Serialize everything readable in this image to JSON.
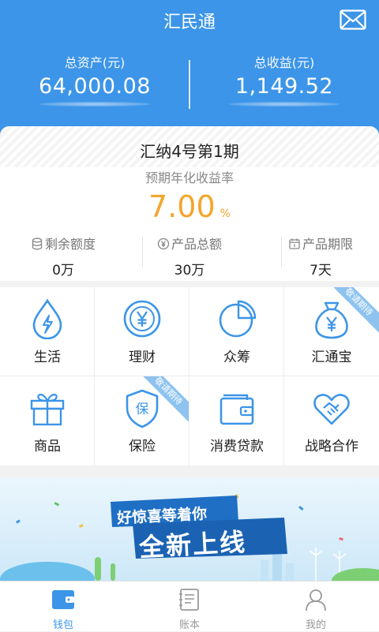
{
  "header": {
    "title": "汇民通",
    "total_assets_label": "总资产(元)",
    "total_assets_value": "64,000.08",
    "total_income_label": "总收益(元)",
    "total_income_value": "1,149.52"
  },
  "product": {
    "name": "汇纳4号第1期",
    "rate_label": "预期年化收益率",
    "rate_value": "7.00",
    "rate_unit": "%",
    "remaining_label": "剩余额度",
    "remaining_value": "0万",
    "total_label": "产品总额",
    "total_value": "30万",
    "term_label": "产品期限",
    "term_value": "7天"
  },
  "grid": {
    "items": [
      {
        "label": "生活",
        "icon": "water-lightning-icon"
      },
      {
        "label": "理财",
        "icon": "yen-coin-icon"
      },
      {
        "label": "众筹",
        "icon": "pie-chart-icon"
      },
      {
        "label": "汇通宝",
        "icon": "money-bag-icon",
        "ribbon": "敬请期待"
      },
      {
        "label": "商品",
        "icon": "gift-icon"
      },
      {
        "label": "保险",
        "icon": "shield-icon",
        "ribbon": "敬请期待",
        "badge": "保"
      },
      {
        "label": "消费贷款",
        "icon": "wallet-icon"
      },
      {
        "label": "战略合作",
        "icon": "handshake-icon"
      }
    ]
  },
  "banner": {
    "line1": "好惊喜等着你",
    "line2": "全新上线"
  },
  "tabbar": {
    "tabs": [
      {
        "label": "钱包",
        "icon": "wallet-icon",
        "active": true
      },
      {
        "label": "账本",
        "icon": "ledger-icon",
        "active": false
      },
      {
        "label": "我的",
        "icon": "user-icon",
        "active": false
      }
    ]
  },
  "colors": {
    "primary": "#3c95e8",
    "rate": "#f4a52c",
    "icon": "#3c95e8"
  }
}
